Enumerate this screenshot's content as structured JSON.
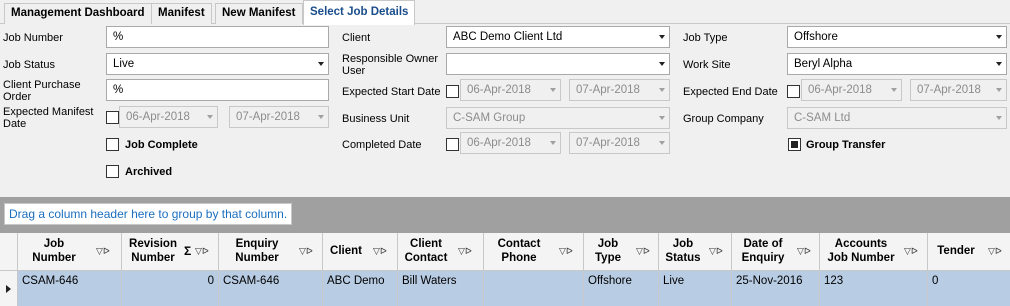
{
  "tabs": [
    {
      "label": "Management Dashboard"
    },
    {
      "label": "Manifest"
    },
    {
      "label": "New Manifest"
    },
    {
      "label": "Select Job Details"
    }
  ],
  "form": {
    "job_number": {
      "label": "Job Number",
      "value": "%"
    },
    "job_status": {
      "label": "Job Status",
      "value": "Live"
    },
    "client_po": {
      "label": "Client Purchase Order",
      "value": "%"
    },
    "expected_manifest_date": {
      "label": "Expected Manifest Date",
      "from": "06-Apr-2018",
      "to": "07-Apr-2018"
    },
    "job_complete": {
      "label": "Job Complete",
      "checked": false
    },
    "archived": {
      "label": "Archived",
      "checked": false
    },
    "client": {
      "label": "Client",
      "value": "ABC Demo Client Ltd"
    },
    "responsible_owner": {
      "label": "Responsible Owner User",
      "value": ""
    },
    "expected_start_date": {
      "label": "Expected Start Date",
      "from": "06-Apr-2018",
      "to": "07-Apr-2018"
    },
    "business_unit": {
      "label": "Business Unit",
      "value": "C-SAM Group"
    },
    "completed_date": {
      "label": "Completed Date",
      "from": "06-Apr-2018",
      "to": "07-Apr-2018"
    },
    "job_type": {
      "label": "Job Type",
      "value": "Offshore"
    },
    "work_site": {
      "label": "Work Site",
      "value": "Beryl Alpha"
    },
    "expected_end_date": {
      "label": "Expected End Date",
      "from": "06-Apr-2018",
      "to": "07-Apr-2018"
    },
    "group_company": {
      "label": "Group Company",
      "value": "C-SAM Ltd"
    },
    "group_transfer": {
      "label": "Group Transfer",
      "checked": true
    }
  },
  "group_hint": "Drag a column header here to group by that column.",
  "grid": {
    "headers": [
      {
        "line1": "Job",
        "line2": "Number"
      },
      {
        "line1": "Revision",
        "line2": "Number"
      },
      {
        "line1": "Enquiry",
        "line2": "Number"
      },
      {
        "line1": "Client",
        "line2": ""
      },
      {
        "line1": "Client",
        "line2": "Contact"
      },
      {
        "line1": "Contact",
        "line2": "Phone"
      },
      {
        "line1": "Job",
        "line2": "Type"
      },
      {
        "line1": "Job",
        "line2": "Status"
      },
      {
        "line1": "Date of",
        "line2": "Enquiry"
      },
      {
        "line1": "Accounts",
        "line2": "Job Number"
      },
      {
        "line1": "Tender",
        "line2": ""
      }
    ],
    "rows": [
      [
        "CSAM-646",
        "0",
        "CSAM-646",
        "ABC Demo",
        "Bill Waters",
        "",
        "Offshore",
        "Live",
        "25-Nov-2016",
        "123",
        "0"
      ]
    ]
  },
  "icons": {
    "filter": "filter-icon",
    "pin": "pin-icon",
    "sigma": "sum-icon",
    "dropdown": "chevron-down-icon",
    "row_pointer": "row-pointer-icon"
  }
}
